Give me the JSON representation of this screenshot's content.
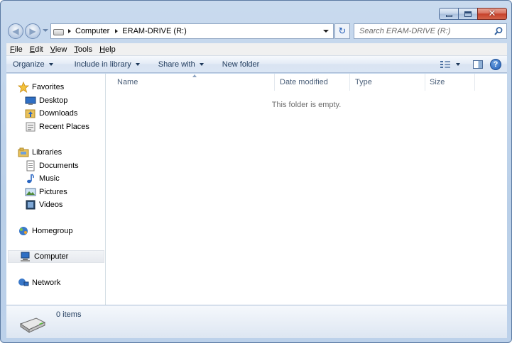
{
  "window": {
    "close_symbol": "✕"
  },
  "navigation": {
    "back_symbol": "◀",
    "forward_symbol": "▶",
    "breadcrumbs": [
      "Computer",
      "ERAM-DRIVE (R:)"
    ],
    "refresh_symbol": "↻",
    "search_placeholder": "Search ERAM-DRIVE (R:)"
  },
  "menu": {
    "items": [
      {
        "key": "F",
        "rest": "ile"
      },
      {
        "key": "E",
        "rest": "dit"
      },
      {
        "key": "V",
        "rest": "iew"
      },
      {
        "key": "T",
        "rest": "ools"
      },
      {
        "key": "H",
        "rest": "elp"
      }
    ]
  },
  "commands": {
    "organize": "Organize",
    "include_in_library": "Include in library",
    "share_with": "Share with",
    "new_folder": "New folder",
    "help_symbol": "?"
  },
  "nav_pane": {
    "favorites": "Favorites",
    "favorites_items": [
      "Desktop",
      "Downloads",
      "Recent Places"
    ],
    "libraries": "Libraries",
    "libraries_items": [
      "Documents",
      "Music",
      "Pictures",
      "Videos"
    ],
    "homegroup": "Homegroup",
    "computer": "Computer",
    "network": "Network"
  },
  "content": {
    "columns": [
      "Name",
      "Date modified",
      "Type",
      "Size"
    ],
    "empty_message": "This folder is empty."
  },
  "details": {
    "item_count": "0 items"
  },
  "colors": {
    "frame": "#b9cfe8",
    "command_bar_text": "#1e395b",
    "selection": "#e6e9ee"
  }
}
